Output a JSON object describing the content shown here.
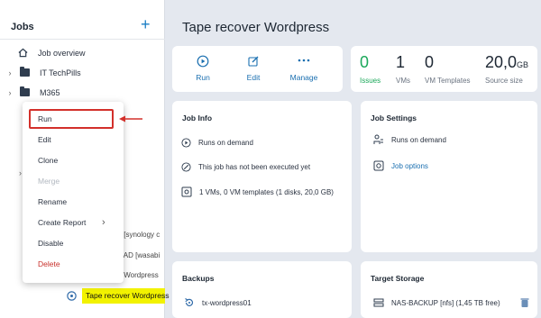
{
  "sidebar": {
    "title": "Jobs",
    "add_label": "+",
    "items": [
      {
        "label": "Job overview"
      },
      {
        "label": "IT TechPills"
      },
      {
        "label": "M365"
      }
    ],
    "partial_rows": [
      "y [synology c",
      "y AD [wasabi",
      "y Wordpress"
    ],
    "selected_label": "Tape recover Wordpress"
  },
  "context_menu": {
    "items": [
      {
        "label": "Run",
        "state": "normal"
      },
      {
        "label": "Edit",
        "state": "normal"
      },
      {
        "label": "Clone",
        "state": "normal"
      },
      {
        "label": "Merge",
        "state": "disabled"
      },
      {
        "label": "Rename",
        "state": "normal"
      },
      {
        "label": "Create Report",
        "state": "submenu"
      },
      {
        "label": "Disable",
        "state": "normal"
      },
      {
        "label": "Delete",
        "state": "danger"
      }
    ]
  },
  "header": {
    "title": "Tape recover Wordpress"
  },
  "actions": {
    "run": "Run",
    "edit": "Edit",
    "manage": "Manage"
  },
  "stats": [
    {
      "value": "0",
      "label": "Issues",
      "color": "#1ba85a"
    },
    {
      "value": "1",
      "label": "VMs"
    },
    {
      "value": "0",
      "label": "VM Templates"
    },
    {
      "value": "20,0",
      "unit": "GB",
      "label": "Source size"
    }
  ],
  "job_info": {
    "title": "Job Info",
    "rows": [
      "Runs on demand",
      "This job has not been executed yet",
      "1 VMs, 0 VM templates (1 disks, 20,0 GB)"
    ]
  },
  "job_settings": {
    "title": "Job Settings",
    "rows": [
      "Runs on demand",
      "Job options"
    ]
  },
  "backups": {
    "title": "Backups",
    "item": "tx-wordpress01"
  },
  "target_storage": {
    "title": "Target Storage",
    "item": "NAS-BACKUP [nfs] (1,45 TB free)"
  },
  "colors": {
    "accent": "#1a7ec4",
    "highlight": "#f2f200",
    "annotation": "#d3302b"
  },
  "icons": [
    "home-icon",
    "folder-icon",
    "play-icon",
    "edit-icon",
    "more-icon",
    "clock-icon",
    "run-icon",
    "disk-icon",
    "schedule-icon",
    "gear-icon",
    "restore-icon",
    "storage-icon",
    "trash-icon"
  ]
}
